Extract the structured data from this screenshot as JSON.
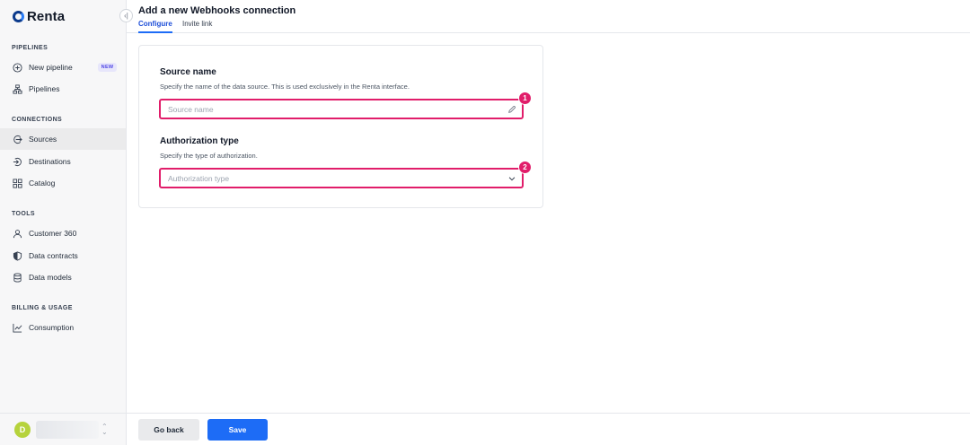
{
  "app": {
    "name": "Renta"
  },
  "sidebar": {
    "sections": [
      {
        "title": "PIPELINES"
      },
      {
        "title": "CONNECTIONS"
      },
      {
        "title": "TOOLS"
      },
      {
        "title": "BILLING & USAGE"
      }
    ],
    "items": [
      {
        "label": "New pipeline",
        "icon": "plus-circle-icon",
        "badge": "NEW"
      },
      {
        "label": "Pipelines",
        "icon": "pipelines-icon"
      },
      {
        "label": "Sources",
        "icon": "sources-icon",
        "active": true
      },
      {
        "label": "Destinations",
        "icon": "destinations-icon"
      },
      {
        "label": "Catalog",
        "icon": "catalog-icon"
      },
      {
        "label": "Customer 360",
        "icon": "user-icon"
      },
      {
        "label": "Data contracts",
        "icon": "shield-icon"
      },
      {
        "label": "Data models",
        "icon": "database-icon"
      },
      {
        "label": "Consumption",
        "icon": "chart-icon"
      }
    ],
    "account": {
      "avatar_letter": "D",
      "avatar_color": "#b6d33c"
    }
  },
  "header": {
    "title": "Add a new Webhooks connection",
    "tabs": [
      {
        "label": "Configure",
        "active": true
      },
      {
        "label": "Invite link"
      }
    ]
  },
  "form": {
    "source_name": {
      "title": "Source name",
      "description": "Specify the name of the data source. This is used exclusively in the Renta interface.",
      "placeholder": "Source name",
      "value": "",
      "marker": "1"
    },
    "authorization_type": {
      "title": "Authorization type",
      "description": "Specify the type of authorization.",
      "placeholder": "Authorization type",
      "marker": "2"
    }
  },
  "footer": {
    "back_label": "Go back",
    "save_label": "Save"
  },
  "colors": {
    "accent": "#1d6cf6",
    "highlight": "#e11d6a",
    "brand": "#0b3a8c"
  }
}
